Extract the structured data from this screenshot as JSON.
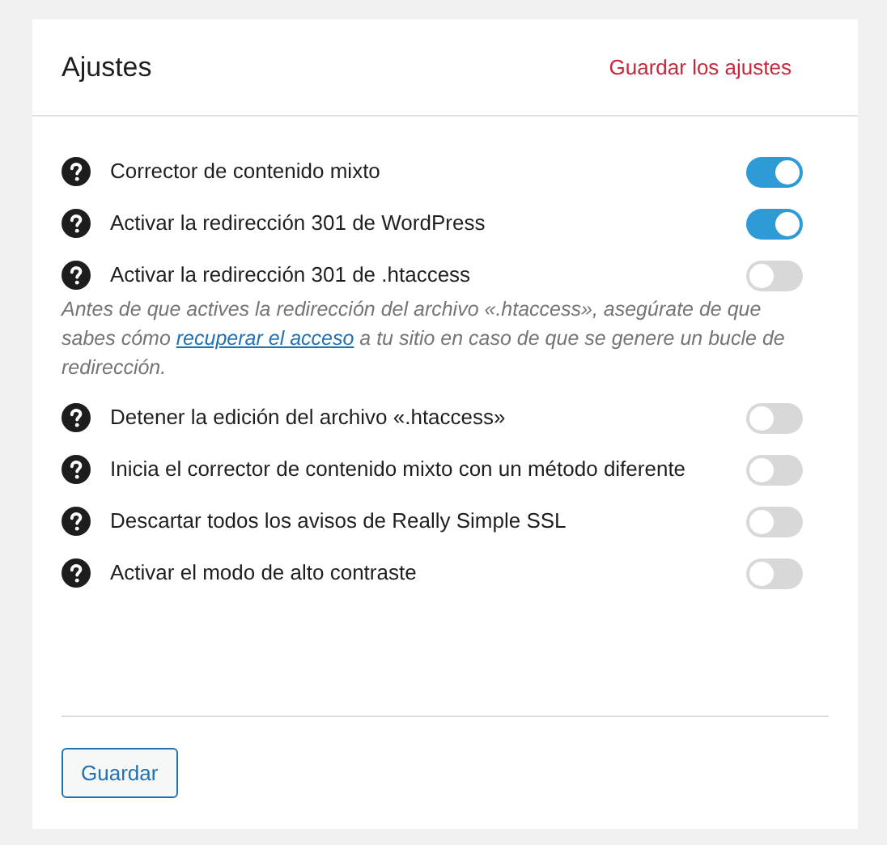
{
  "header": {
    "title": "Ajustes",
    "save_link": "Guardar los ajustes"
  },
  "settings": [
    {
      "label": "Corrector de contenido mixto",
      "on": true
    },
    {
      "label": "Activar la redirección 301 de WordPress",
      "on": true
    },
    {
      "label": "Activar la redirección 301 de .htaccess",
      "on": false,
      "note": {
        "before": "Antes de que actives la redirección del archivo «.htaccess», asegúrate de que sabes cómo",
        "link": "recuperar el acceso",
        "after": "a tu sitio en caso de que se genere un bucle de redirección."
      }
    },
    {
      "label": "Detener la edición del archivo «.htaccess»",
      "on": false
    },
    {
      "label": "Inicia el corrector de contenido mixto con un método diferente",
      "on": false
    },
    {
      "label": "Descartar todos los avisos de Really Simple SSL",
      "on": false
    },
    {
      "label": "Activar el modo de alto contraste",
      "on": false
    }
  ],
  "footer": {
    "button": "Guardar"
  }
}
